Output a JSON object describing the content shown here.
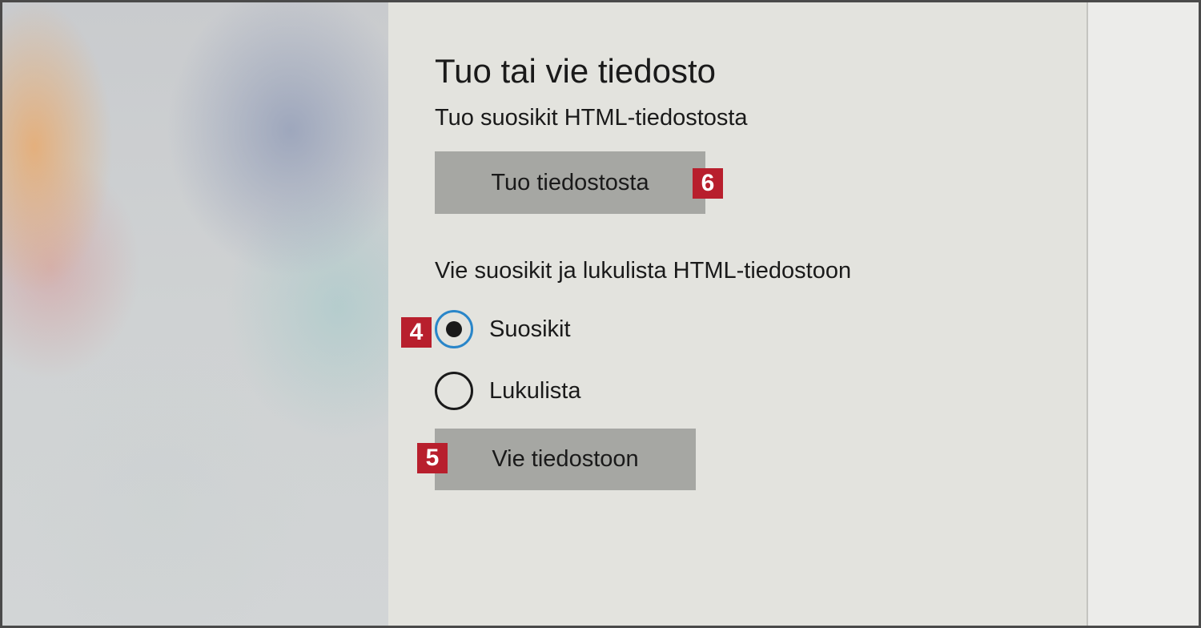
{
  "panel": {
    "title": "Tuo tai vie tiedosto",
    "import": {
      "description": "Tuo suosikit HTML-tiedostosta",
      "button_label": "Tuo tiedostosta"
    },
    "export": {
      "description": "Vie suosikit ja lukulista HTML-tiedostoon",
      "options": [
        {
          "label": "Suosikit",
          "selected": true
        },
        {
          "label": "Lukulista",
          "selected": false
        }
      ],
      "button_label": "Vie tiedostoon"
    }
  },
  "callouts": {
    "import_button": "6",
    "favorites_radio": "4",
    "export_button": "5"
  },
  "colors": {
    "panel_background": "#e3e3de",
    "button_background": "#a6a7a3",
    "radio_accent": "#2a86c9",
    "callout_red": "#b81f2d"
  }
}
